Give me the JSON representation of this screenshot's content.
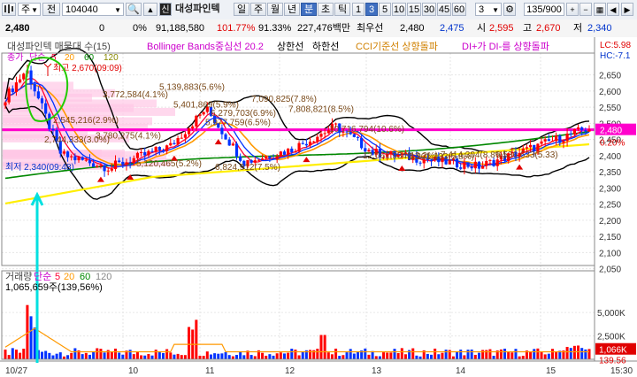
{
  "toolbar": {
    "market": "주",
    "period_label": "전",
    "code": "104040",
    "code_prefix": "신",
    "stock_name": "대성파인텍",
    "periods": [
      "일",
      "주",
      "월",
      "년",
      "분",
      "초",
      "틱"
    ],
    "active_period": "분",
    "intervals": [
      "1",
      "3",
      "5",
      "10",
      "15",
      "30",
      "45",
      "60"
    ],
    "active_interval": "3",
    "interval_select": "3",
    "count": "135/900"
  },
  "info": {
    "price": "2,480",
    "change": "0",
    "change_pct": "0%",
    "volume": "91,188,580",
    "vol_ratio": "101.77%",
    "turnover": "91.33%",
    "amount": "227,476백만",
    "best_ask_label": "최우선",
    "best_ask": "2,480",
    "best_bid": "2,475",
    "open_label": "시",
    "open": "2,595",
    "high_label": "고",
    "high": "2,670",
    "low_label": "저",
    "low": "2,340"
  },
  "legend": {
    "main": "대성파인텍 매물대 수(15)",
    "bollinger": "Bollinger Bands중심선 20.2",
    "upper": "상한선",
    "lower": "하한선",
    "cci": "CCI기준선 상향돌파",
    "dmi": "DI+가 DI-를 상향돌파",
    "lc": "LC:5.98",
    "hc": "HC:-7.1",
    "ma_labels": [
      "종가",
      "단순",
      "5",
      "20",
      "60",
      "120"
    ]
  },
  "colors": {
    "ma5": "#ff0033",
    "ma20": "#ff9900",
    "ma60": "#008800",
    "ma120": "#ffee00",
    "bb": "#000000",
    "level": "#ff00cc",
    "up": "#ff0000",
    "down": "#0033ff"
  },
  "chart_data": {
    "type": "candlestick",
    "price_axis": {
      "ticks": [
        "2,650",
        "2,600",
        "2,550",
        "2,500",
        "2,450",
        "2,400",
        "2,350",
        "2,300",
        "2,250",
        "2,200",
        "2,150",
        "2,100",
        "2,050"
      ],
      "range": [
        2060,
        2690
      ]
    },
    "current_price": "2,480",
    "current_pct": "0.20%",
    "high_label": "최고 2,670(09:09)",
    "low_label": "최저 2,340(09:48)",
    "annotations": [
      {
        "text": "5,139,883(5.6%)",
        "price": 2615
      },
      {
        "text": "3,772,584(4.1%)",
        "price": 2592
      },
      {
        "text": "5,401,869(5.9%)",
        "price": 2560
      },
      {
        "text": "7,090,825(7.8%)",
        "price": 2578
      },
      {
        "text": "7,808,821(8.5%)",
        "price": 2546
      },
      {
        "text": "6,279,703(6.9%)",
        "price": 2534
      },
      {
        "text": "2,545,216(2.9%)",
        "price": 2512
      },
      {
        "text": "5,977,759(6.5%)",
        "price": 2505
      },
      {
        "text": "3,780,275(4.1%)",
        "price": 2464
      },
      {
        "text": "2,744,333(3.0%)",
        "price": 2452
      },
      {
        "text": "5,120,465(5.2%)",
        "price": 2378
      },
      {
        "text": "6,824,912(7.5%)",
        "price": 2367
      },
      {
        "text": "10,716,794(10.6%)",
        "price": 2484
      },
      {
        "text": "12,061,934(13.2%)",
        "price": 2402
      },
      {
        "text": "7,414,304(8.8%)",
        "price": 2405
      },
      {
        "text": "5,201,133(5.8%)",
        "price": 2400
      },
      {
        "text": "6,536,633(5.33)",
        "price": 2405
      }
    ],
    "volume_panel": {
      "title": "거래량",
      "ma_label": "단순",
      "ma_periods": [
        "5",
        "20",
        "60",
        "120"
      ],
      "info": "1,065,659주(139,56%)",
      "axis_ticks": [
        "5,000K",
        "2,500K"
      ],
      "last_value": "1,066K",
      "last_pct": "139.56"
    },
    "time_axis": [
      "10/27",
      "10",
      "11",
      "12",
      "13",
      "14",
      "15",
      "15:30"
    ]
  }
}
